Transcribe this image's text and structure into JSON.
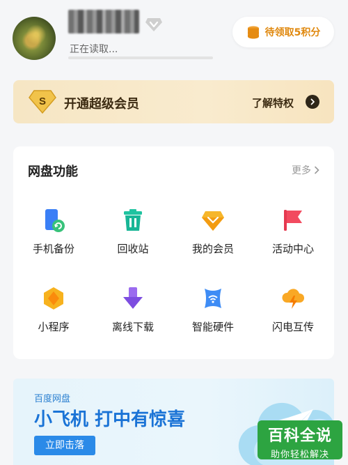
{
  "profile": {
    "status_text": "正在读取...",
    "points_label": "待领取5积分"
  },
  "vip_banner": {
    "badge_letter": "S",
    "title": "开通超级会员",
    "link": "了解特权"
  },
  "features": {
    "title": "网盘功能",
    "more": "更多",
    "items": [
      {
        "label": "手机备份",
        "icon": "phone-backup-icon"
      },
      {
        "label": "回收站",
        "icon": "recycle-bin-icon"
      },
      {
        "label": "我的会员",
        "icon": "membership-diamond-icon"
      },
      {
        "label": "活动中心",
        "icon": "flag-icon"
      },
      {
        "label": "小程序",
        "icon": "mini-program-icon"
      },
      {
        "label": "离线下载",
        "icon": "download-arrow-icon"
      },
      {
        "label": "智能硬件",
        "icon": "smart-hardware-icon"
      },
      {
        "label": "闪电互传",
        "icon": "lightning-cloud-icon"
      }
    ]
  },
  "promo": {
    "brand": "百度网盘",
    "title": "小飞机 打中有惊喜",
    "button": "立即击落"
  },
  "watermark": {
    "title": "百科全说",
    "subtitle": "助你轻松解决"
  },
  "colors": {
    "accent_orange": "#e0890f",
    "vip_gold": "#f6e6c4",
    "promo_blue": "#1a73d6",
    "watermark_green": "#2da441"
  }
}
